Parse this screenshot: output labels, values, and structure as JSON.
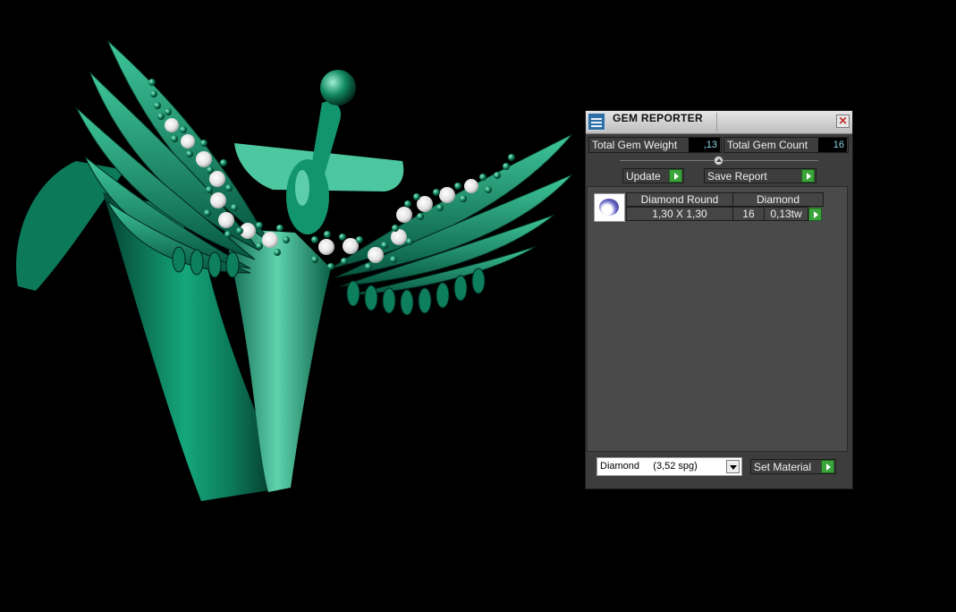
{
  "viewport": {
    "description_name": "ring-3d-viewport"
  },
  "panel": {
    "title": "GEM REPORTER",
    "close_symbol": "✕",
    "total_gem_weight_label": "Total Gem Weight",
    "total_gem_weight_value": ",13",
    "total_gem_count_label": "Total Gem Count",
    "total_gem_count_value": "16",
    "update_label": "Update",
    "save_report_label": "Save Report",
    "gems": [
      {
        "name": "Diamond Round",
        "material": "Diamond",
        "size": "1,30 X 1,30",
        "count": "16",
        "weight": "0,13tw"
      }
    ],
    "material_select_value": "Diamond     (3,52 spg)",
    "set_material_label": "Set Material"
  },
  "colors": {
    "ring_green": "#0f8a66",
    "ring_light": "#5fd3ad",
    "panel_bg": "#3d3d3d",
    "accent_green": "#3aa33a"
  }
}
